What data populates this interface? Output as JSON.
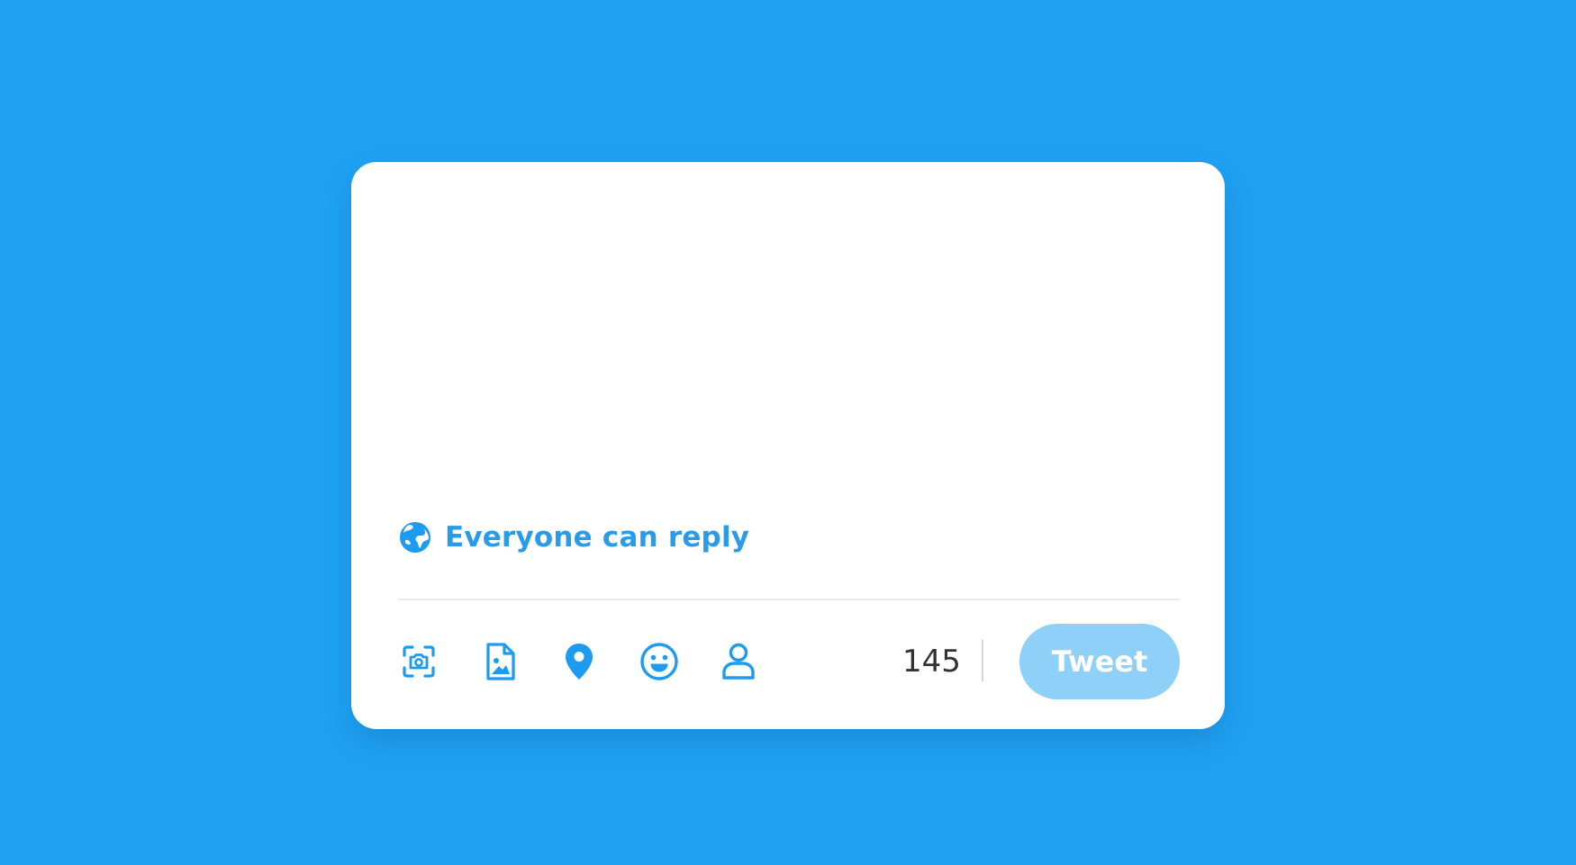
{
  "composer": {
    "text": "",
    "placeholder": ""
  },
  "reply_setting": {
    "label": "Everyone can reply",
    "icon": "globe-icon"
  },
  "toolbar": {
    "icons": [
      "camera-scan-icon",
      "image-file-icon",
      "location-pin-icon",
      "emoji-icon",
      "user-icon"
    ],
    "char_count": "145",
    "tweet_label": "Tweet"
  },
  "colors": {
    "background": "#1fa1f2",
    "accent": "#1d9bf0",
    "tweet_button_disabled": "#8fd0f8"
  }
}
